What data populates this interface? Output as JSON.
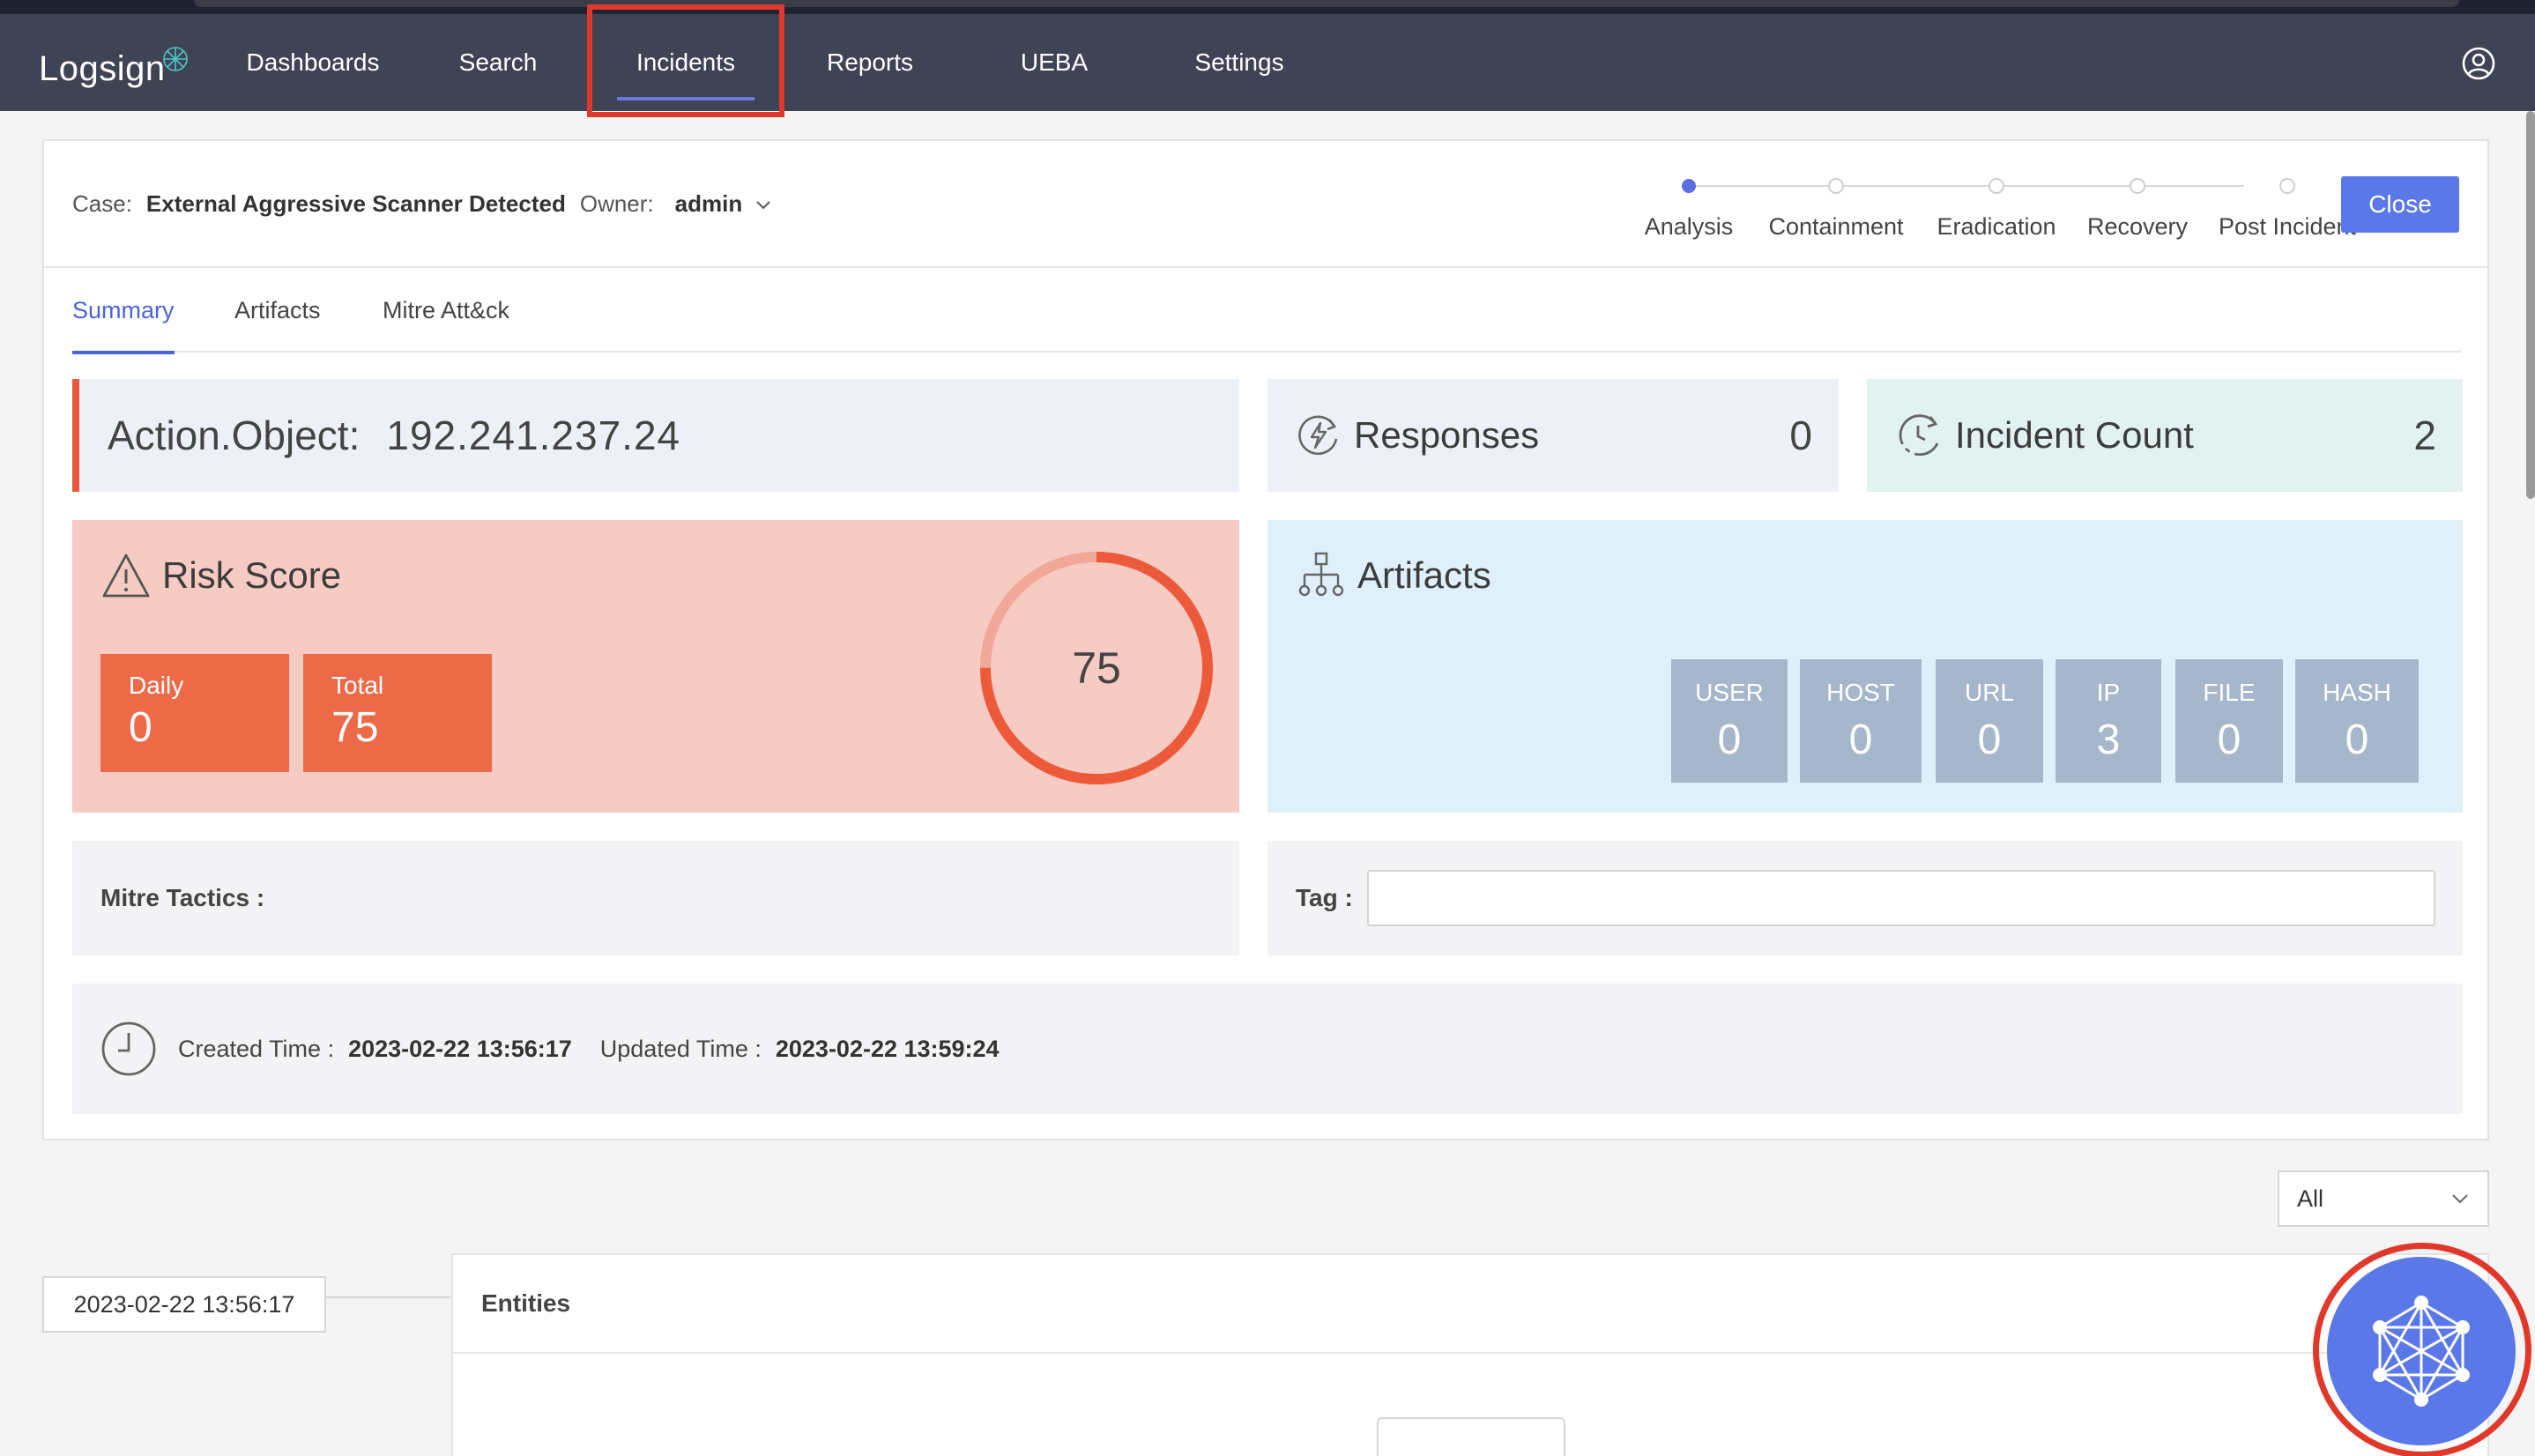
{
  "app": {
    "logo_text": "Logsign"
  },
  "nav": {
    "items": [
      {
        "label": "Dashboards"
      },
      {
        "label": "Search"
      },
      {
        "label": "Incidents"
      },
      {
        "label": "Reports"
      },
      {
        "label": "UEBA"
      },
      {
        "label": "Settings"
      }
    ],
    "active": "Incidents"
  },
  "case": {
    "case_label": "Case:",
    "case_name": "External Aggressive Scanner Detected",
    "owner_label": "Owner:",
    "owner_value": "admin"
  },
  "stepper": {
    "steps": [
      "Analysis",
      "Containment",
      "Eradication",
      "Recovery",
      "Post Incident"
    ],
    "current": "Analysis"
  },
  "close_button": "Close",
  "tabs": [
    {
      "label": "Summary"
    },
    {
      "label": "Artifacts"
    },
    {
      "label": "Mitre Att&ck"
    }
  ],
  "action_object": {
    "label": "Action.Object:",
    "value": "192.241.237.24"
  },
  "responses": {
    "label": "Responses",
    "count": "0"
  },
  "incident_count": {
    "label": "Incident Count",
    "count": "2"
  },
  "risk_score": {
    "label": "Risk Score",
    "daily_label": "Daily",
    "daily_value": "0",
    "total_label": "Total",
    "total_value": "75",
    "gauge_value": "75",
    "gauge_fraction": 0.75
  },
  "artifacts": {
    "label": "Artifacts",
    "chips": [
      {
        "label": "USER",
        "value": "0"
      },
      {
        "label": "HOST",
        "value": "0"
      },
      {
        "label": "URL",
        "value": "0"
      },
      {
        "label": "IP",
        "value": "3"
      },
      {
        "label": "FILE",
        "value": "0"
      },
      {
        "label": "HASH",
        "value": "0"
      }
    ]
  },
  "mitre_tactics": {
    "label": "Mitre Tactics :"
  },
  "tag": {
    "label": "Tag :",
    "value": ""
  },
  "times": {
    "created_label": "Created Time :",
    "created_value": "2023-02-22 13:56:17",
    "updated_label": "Updated Time :",
    "updated_value": "2023-02-22 13:59:24"
  },
  "filter": {
    "selected": "All"
  },
  "timeline": {
    "date": "2023-02-22 13:56:17"
  },
  "entities": {
    "label": "Entities"
  },
  "colors": {
    "accent": "#5b78e8",
    "risk_bg": "#f6cbc3",
    "risk_orange": "#ec6a47",
    "artifact_bg": "#dff0fb",
    "chip": "#a6b7cc",
    "highlight": "#e0382a"
  }
}
